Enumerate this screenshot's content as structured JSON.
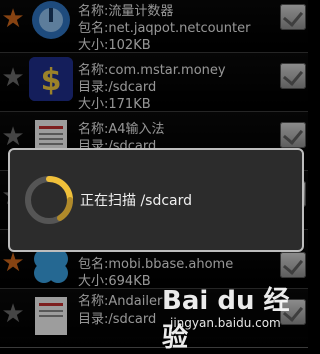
{
  "apps": [
    {
      "icon": "chart-app-icon",
      "name": "名称:流量计数器",
      "line2": "包名:net.jaqpot.netcounter",
      "line3": "大小:102KB",
      "favorite": true
    },
    {
      "icon": "dollar-app-icon",
      "name": "名称:com.mstar.money",
      "line2": "目录:/sdcard",
      "line3": "大小:171KB",
      "favorite": false
    },
    {
      "icon": "document-app-icon",
      "name": "名称:A4输入法",
      "line2": "目录:/sdcard",
      "line3": "",
      "favorite": false
    },
    {
      "icon": "android-app-icon",
      "name": "",
      "line2": "",
      "line3": "",
      "favorite": false
    },
    {
      "icon": "clover-app-icon",
      "name": "",
      "line2": "包名:mobi.bbase.ahome",
      "line3": "大小:694KB",
      "favorite": true
    },
    {
      "icon": "document-app-icon",
      "name": "名称:Andailer",
      "line2": "目录:/sdcard",
      "line3": "",
      "favorite": false
    }
  ],
  "dialog": {
    "message": "正在扫描 /sdcard"
  },
  "watermark": {
    "logo": "Bai du 经验",
    "url": "jingyan.baidu.com"
  }
}
